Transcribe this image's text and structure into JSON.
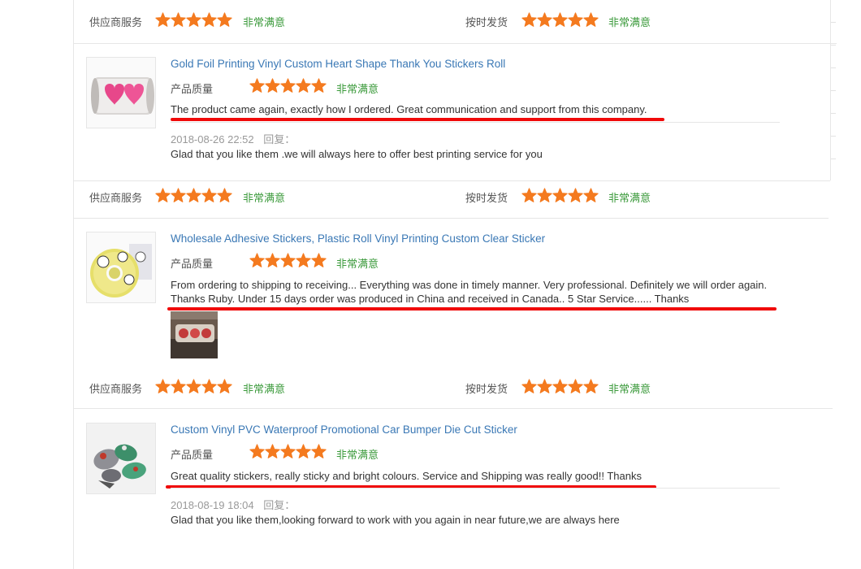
{
  "ratings": {
    "supplier_service_label": "供应商服务",
    "on_time_delivery_label": "按时发货",
    "product_quality_label": "产品质量",
    "rating_text": "非常满意",
    "stars": 5
  },
  "reviews": [
    {
      "title": "Gold Foil Printing Vinyl Custom Heart Shape Thank You Stickers Roll",
      "comment": "The product came again, exactly how I ordered. Great communication and support from this company.",
      "reply_date": "2018-08-26 22:52",
      "reply_label": "回复：",
      "reply_text": "Glad that you like them .we will always here to offer best printing service for you"
    },
    {
      "title": "Wholesale Adhesive Stickers, Plastic Roll Vinyl Printing Custom Clear Sticker",
      "comment_line1": "From ordering to shipping to receiving... Everything was done in timely manner. Very professional. Definitely we will order again.",
      "comment_line2": "Thanks Ruby. Under 15 days order was produced in China and received in Canada.. 5 Star Service...... Thanks"
    },
    {
      "title": "Custom Vinyl PVC Waterproof Promotional Car Bumper Die Cut Sticker",
      "comment": "Great quality stickers, really sticky and bright colours. Service and Shipping was really good!! Thanks",
      "reply_date": "2018-08-19 18:04",
      "reply_label": "回复：",
      "reply_text": "Glad that you like them,looking forward to work with you again in near future,we are always here"
    }
  ],
  "colors": {
    "star": "#f47a1f",
    "rating_text": "#3b9a3b",
    "title_link": "#3a78b5",
    "highlight_underline": "#f00a0a"
  },
  "icons": {
    "star": "star-icon"
  }
}
